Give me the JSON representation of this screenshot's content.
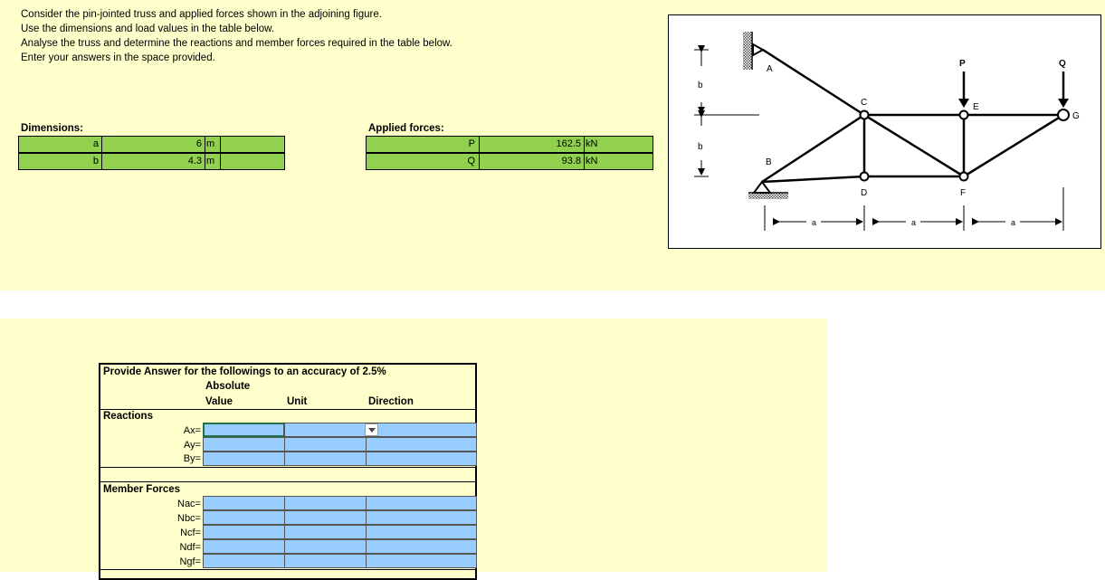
{
  "intro": [
    "Consider the pin-jointed truss and applied forces shown in the adjoining figure.",
    "Use the dimensions and load values in the table below.",
    "Analyse the truss and determine the reactions and member forces required in the table below.",
    "Enter your answers in the space provided."
  ],
  "dimensions": {
    "title": "Dimensions:",
    "rows": [
      {
        "name": "a",
        "value": "6",
        "unit": "m"
      },
      {
        "name": "b",
        "value": "4.3",
        "unit": "m"
      }
    ]
  },
  "forces": {
    "title": "Applied forces:",
    "rows": [
      {
        "name": "P",
        "value": "162.5",
        "unit": "kN"
      },
      {
        "name": "Q",
        "value": "93.8",
        "unit": "kN"
      }
    ]
  },
  "figure": {
    "labels": {
      "A": "A",
      "B": "B",
      "C": "C",
      "D": "D",
      "E": "E",
      "F": "F",
      "G": "G",
      "P": "P",
      "Q": "Q",
      "b": "b",
      "a": "a"
    }
  },
  "answer_table": {
    "title": "Provide Answer for the followings to an accuracy of 2.5%",
    "header_abs": "Absolute",
    "header_value": "Value",
    "header_unit": "Unit",
    "header_direction": "Direction",
    "reactions_title": "Reactions",
    "reactions": [
      "Ax=",
      "Ay=",
      "By="
    ],
    "members_title": "Member Forces",
    "members": [
      "Nac=",
      "Nbc=",
      "Ncf=",
      "Ndf=",
      "Ngf="
    ]
  },
  "colors": {
    "sheet_bg": "#ffffcc",
    "input_green": "#92d050",
    "answer_blue": "#99ccff"
  }
}
